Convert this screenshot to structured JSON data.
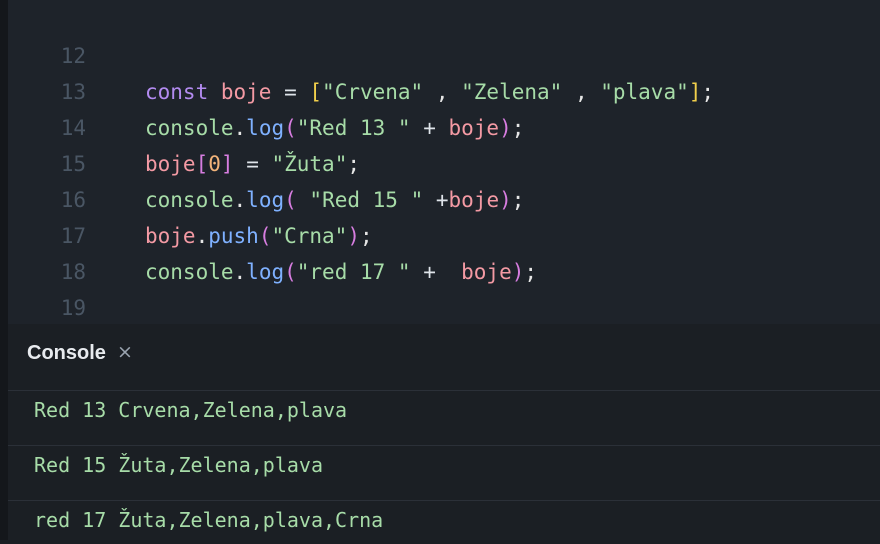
{
  "editor": {
    "lines": [
      {
        "number": "12",
        "tokens": [
          {
            "t": "const",
            "c": "kw"
          },
          {
            "t": " ",
            "c": "op"
          },
          {
            "t": "boje",
            "c": "var"
          },
          {
            "t": " = ",
            "c": "op"
          },
          {
            "t": "[",
            "c": "b1"
          },
          {
            "t": "\"Crvena\"",
            "c": "str"
          },
          {
            "t": " , ",
            "c": "punct"
          },
          {
            "t": "\"Zelena\"",
            "c": "str"
          },
          {
            "t": " , ",
            "c": "punct"
          },
          {
            "t": "\"plava\"",
            "c": "str"
          },
          {
            "t": "]",
            "c": "b1"
          },
          {
            "t": ";",
            "c": "punct"
          }
        ]
      },
      {
        "number": "13",
        "tokens": [
          {
            "t": "console",
            "c": "str"
          },
          {
            "t": ".",
            "c": "punct"
          },
          {
            "t": "log",
            "c": "fn"
          },
          {
            "t": "(",
            "c": "b2"
          },
          {
            "t": "\"Red 13 \"",
            "c": "str"
          },
          {
            "t": " + ",
            "c": "op"
          },
          {
            "t": "boje",
            "c": "var"
          },
          {
            "t": ")",
            "c": "b2"
          },
          {
            "t": ";",
            "c": "punct"
          }
        ]
      },
      {
        "number": "14",
        "tokens": [
          {
            "t": "boje",
            "c": "var"
          },
          {
            "t": "[",
            "c": "b2"
          },
          {
            "t": "0",
            "c": "num"
          },
          {
            "t": "]",
            "c": "b2"
          },
          {
            "t": " = ",
            "c": "op"
          },
          {
            "t": "\"Žuta\"",
            "c": "str"
          },
          {
            "t": ";",
            "c": "punct"
          }
        ]
      },
      {
        "number": "15",
        "tokens": [
          {
            "t": "console",
            "c": "str"
          },
          {
            "t": ".",
            "c": "punct"
          },
          {
            "t": "log",
            "c": "fn"
          },
          {
            "t": "(",
            "c": "b2"
          },
          {
            "t": " ",
            "c": "op"
          },
          {
            "t": "\"Red 15 \"",
            "c": "str"
          },
          {
            "t": " +",
            "c": "op"
          },
          {
            "t": "boje",
            "c": "var"
          },
          {
            "t": ")",
            "c": "b2"
          },
          {
            "t": ";",
            "c": "punct"
          }
        ]
      },
      {
        "number": "16",
        "tokens": [
          {
            "t": "boje",
            "c": "var"
          },
          {
            "t": ".",
            "c": "punct"
          },
          {
            "t": "push",
            "c": "fn"
          },
          {
            "t": "(",
            "c": "b2"
          },
          {
            "t": "\"Crna\"",
            "c": "str"
          },
          {
            "t": ")",
            "c": "b2"
          },
          {
            "t": ";",
            "c": "punct"
          }
        ]
      },
      {
        "number": "17",
        "tokens": [
          {
            "t": "console",
            "c": "str"
          },
          {
            "t": ".",
            "c": "punct"
          },
          {
            "t": "log",
            "c": "fn"
          },
          {
            "t": "(",
            "c": "b2"
          },
          {
            "t": "\"red 17 \"",
            "c": "str"
          },
          {
            "t": " +  ",
            "c": "op"
          },
          {
            "t": "boje",
            "c": "var"
          },
          {
            "t": ")",
            "c": "b2"
          },
          {
            "t": ";",
            "c": "punct"
          }
        ]
      },
      {
        "number": "18",
        "tokens": []
      },
      {
        "number": "19",
        "tokens": []
      }
    ]
  },
  "console": {
    "title": "Console",
    "close_icon": "×",
    "outputs": [
      "Red 13 Crvena,Zelena,plava",
      "Red 15 Žuta,Zelena,plava",
      "red 17 Žuta,Zelena,plava,Crna"
    ]
  },
  "colors": {
    "background": "#1b1f24",
    "editor_background": "#1e232a",
    "keyword": "#b38bf0",
    "variable": "#f49aa4",
    "string": "#a7dca8",
    "function": "#7fb1ff",
    "number": "#f2b37a",
    "bracket_level1": "#f1cf4b",
    "bracket_level2": "#d77de0",
    "line_number": "#4a5664"
  }
}
